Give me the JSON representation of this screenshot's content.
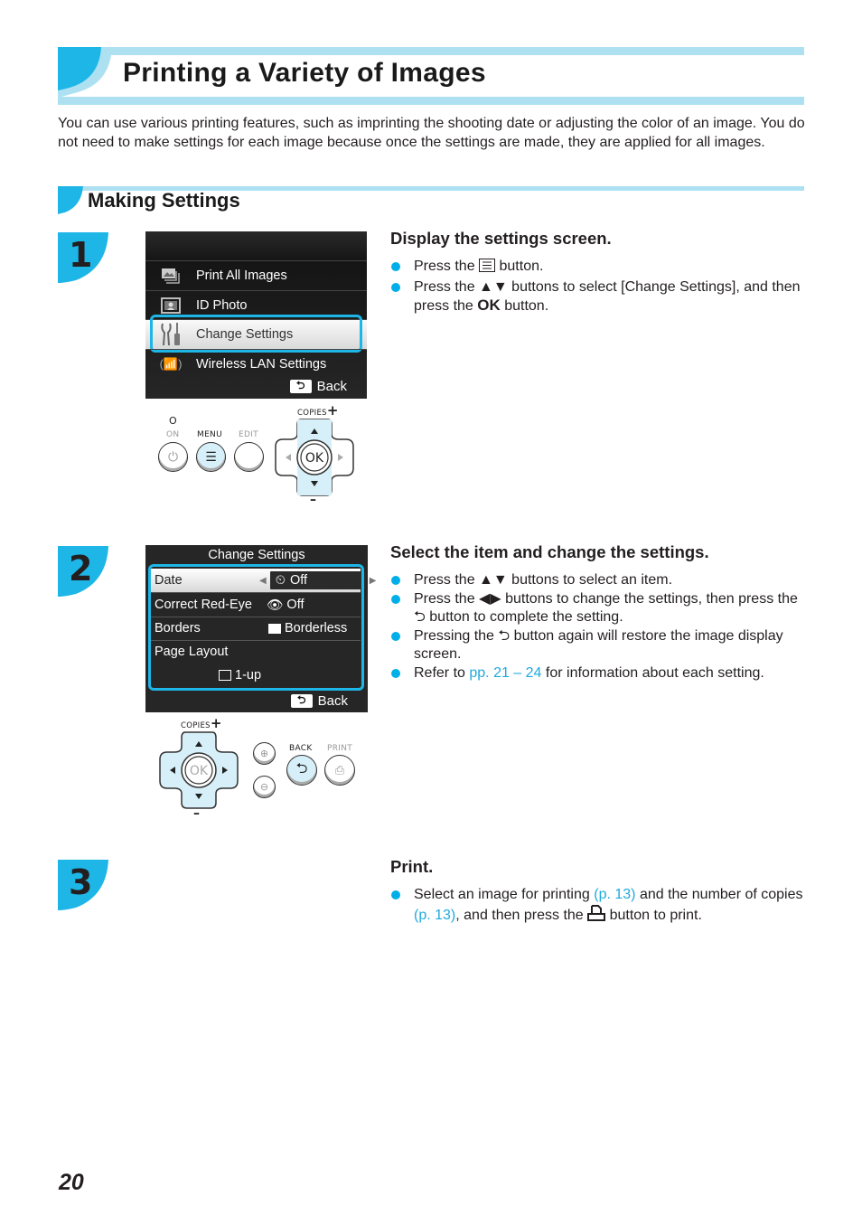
{
  "page": {
    "title": "Printing a Variety of Images",
    "intro": "You can use various printing features, such as imprinting the shooting date or adjusting the color of an image. You do not need to make settings for each image because once the settings are made, they are applied for all images.",
    "page_number": "20",
    "accent_color": "#1db6e6",
    "band_color": "#ade1f2"
  },
  "section": {
    "title": "Making Settings"
  },
  "steps": [
    {
      "number": "1",
      "heading": "Display the settings screen.",
      "bullets": [
        {
          "pre": "Press the",
          "icon": "menu-icon",
          "post": "button."
        },
        {
          "pre": "Press the",
          "icon": "up-down-arrows-icon",
          "mid": "buttons to select [Change Settings], and then press the",
          "ok": "OK",
          "post": "button."
        }
      ],
      "screen": {
        "menu_items": [
          {
            "label": "Print All Images",
            "icon": "images-icon",
            "selected": false
          },
          {
            "label": "ID Photo",
            "icon": "id-photo-icon",
            "selected": false
          },
          {
            "label": "Change Settings",
            "icon": "tools-icon",
            "selected": true
          },
          {
            "label": "Wireless LAN Settings",
            "icon": "wireless-icon",
            "selected": false
          }
        ],
        "back_label": "Back"
      },
      "controls": {
        "on_indicator": "O",
        "on_label": "ON",
        "menu_label": "MENU",
        "edit_label": "EDIT",
        "copies_label": "COPIES",
        "plus": "+",
        "minus": "–",
        "ok_label": "OK"
      }
    },
    {
      "number": "2",
      "heading": "Select the item and change the settings.",
      "bullets": [
        {
          "pre": "Press the",
          "icon": "up-down-arrows-icon",
          "post": "buttons to select an item."
        },
        {
          "pre": "Press the",
          "icon": "left-right-arrows-icon",
          "mid": "buttons to change the settings, then press the",
          "icon2": "back-icon",
          "post": "button to complete the setting."
        },
        {
          "pre": "Pressing the",
          "icon": "back-icon",
          "post": "button again will restore the image display screen."
        },
        {
          "pre": "Refer to",
          "link": "pp. 21 – 24",
          "post": "for information about each setting."
        }
      ],
      "screen": {
        "title": "Change Settings",
        "rows": [
          {
            "label": "Date",
            "value": "Off",
            "icon": "date-off-icon",
            "selected": true
          },
          {
            "label": "Correct Red-Eye",
            "value": "Off",
            "icon": "red-eye-off-icon",
            "selected": false
          },
          {
            "label": "Borders",
            "value": "Borderless",
            "icon": "borderless-icon",
            "selected": false
          },
          {
            "label": "Page Layout",
            "value": "1-up",
            "icon": "layout-1up-icon",
            "selected": false
          }
        ],
        "back_label": "Back"
      },
      "controls": {
        "copies_label": "COPIES",
        "plus": "+",
        "minus": "–",
        "ok_label": "OK",
        "back_label": "BACK",
        "print_label": "PRINT"
      }
    },
    {
      "number": "3",
      "heading": "Print.",
      "bullets": [
        {
          "pre": "Select an image for printing",
          "link": "(p. 13)",
          "mid": "and the number of copies",
          "link2": "(p. 13)",
          "mid2": ", and then press the",
          "icon": "print-icon",
          "post": "button to print."
        }
      ]
    }
  ]
}
